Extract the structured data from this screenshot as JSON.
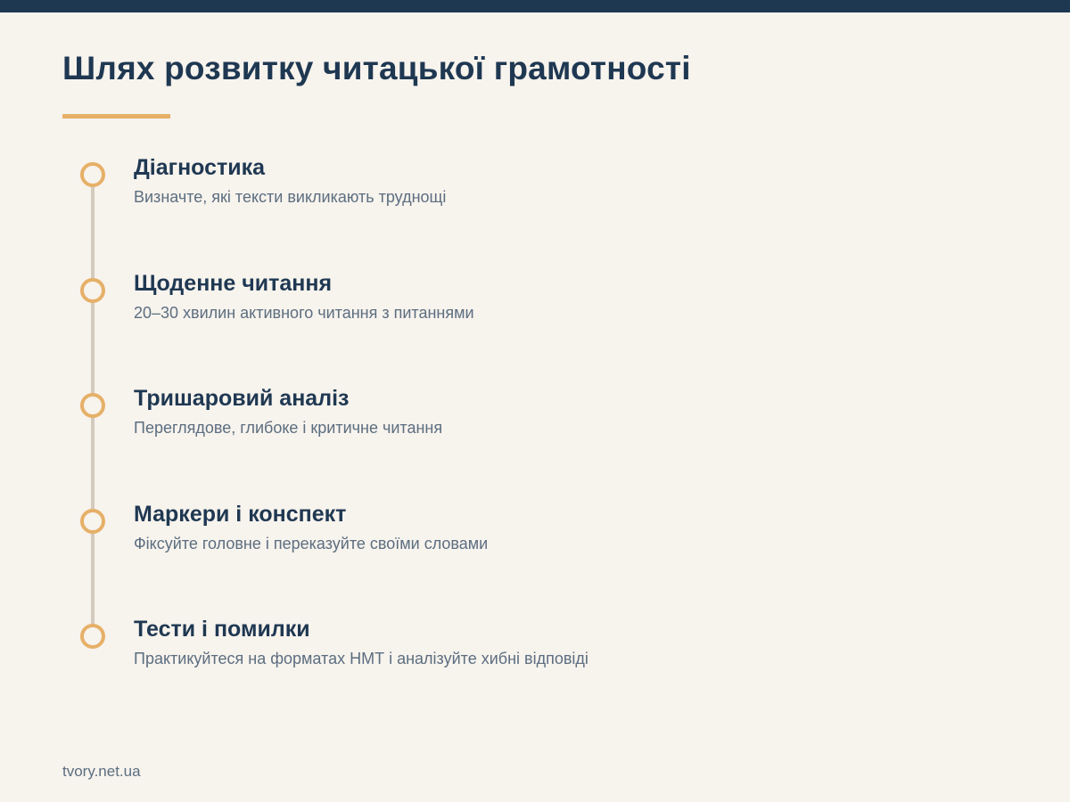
{
  "header": {
    "title": "Шлях розвитку читацької грамотності"
  },
  "steps": [
    {
      "title": "Діагностика",
      "description": "Визначте, які тексти викликають труднощі"
    },
    {
      "title": "Щоденне читання",
      "description": "20–30 хвилин активного читання з питаннями"
    },
    {
      "title": "Тришаровий аналіз",
      "description": "Переглядове, глибоке і критичне читання"
    },
    {
      "title": "Маркери і конспект",
      "description": "Фіксуйте головне і переказуйте своїми словами"
    },
    {
      "title": "Тести і помилки",
      "description": "Практикуйтеся на форматах НМТ і аналізуйте хибні відповіді"
    }
  ],
  "footer": {
    "source": "tvory.net.ua"
  },
  "colors": {
    "background": "#f7f3ed",
    "primary": "#1f3852",
    "accent": "#e6b068",
    "timeline": "#d4cabd",
    "muted_text": "#5c6e80"
  }
}
